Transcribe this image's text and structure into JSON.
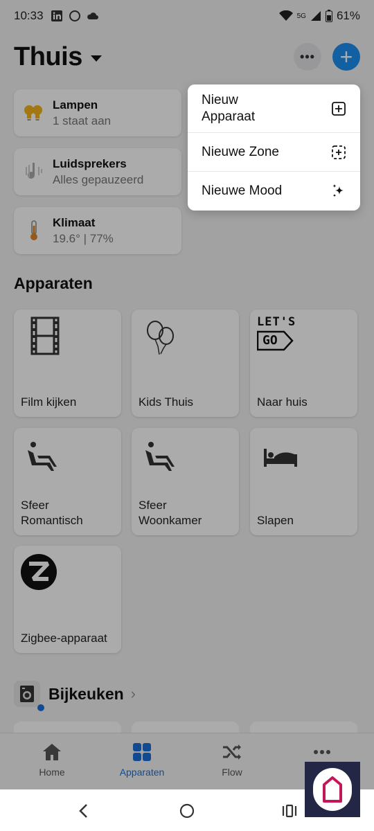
{
  "status_bar": {
    "time": "10:33",
    "network": "5G",
    "battery": "61%"
  },
  "header": {
    "title": "Thuis",
    "more_label": "•••",
    "add_label": "+"
  },
  "status_cards": [
    {
      "title": "Lampen",
      "subtitle": "1 staat aan"
    },
    {
      "title": "Luidsprekers",
      "subtitle": "Alles gepauzeerd"
    },
    {
      "title": "Klimaat",
      "subtitle": "19.6°  |  77%"
    }
  ],
  "section_title": "Apparaten",
  "tiles": [
    {
      "label": "Film kijken",
      "icon": "film-icon"
    },
    {
      "label": "Kids Thuis",
      "icon": "balloons-icon"
    },
    {
      "label": "Naar huis",
      "icon": "lets-go-icon",
      "icon_text_1": "LET'S",
      "icon_text_2": "GO"
    },
    {
      "label": "Sfeer\nRomantisch",
      "icon": "armchair-icon"
    },
    {
      "label": "Sfeer\nWoonkamer",
      "icon": "armchair-icon"
    },
    {
      "label": "Slapen",
      "icon": "bed-icon"
    },
    {
      "label": "Zigbee-apparaat",
      "icon": "zigbee-icon"
    }
  ],
  "zone": {
    "title": "Bijkeuken",
    "chevron": "›"
  },
  "bottom_nav": [
    {
      "label": "Home",
      "icon": "home-icon"
    },
    {
      "label": "Apparaten",
      "icon": "grid-icon",
      "active": true
    },
    {
      "label": "Flow",
      "icon": "shuffle-icon"
    },
    {
      "label": "",
      "icon": "more-icon"
    }
  ],
  "menu": [
    {
      "label": "Nieuw\nApparaat",
      "icon": "plus-square-icon"
    },
    {
      "label": "Nieuwe Zone",
      "icon": "dashed-plus-square-icon"
    },
    {
      "label": "Nieuwe Mood",
      "icon": "sparkle-icon"
    }
  ],
  "colors": {
    "accent": "#1c8ef0",
    "active_nav": "#1a6fd8",
    "app_badge_bg": "#232745",
    "app_badge_logo": "#c2185b"
  }
}
